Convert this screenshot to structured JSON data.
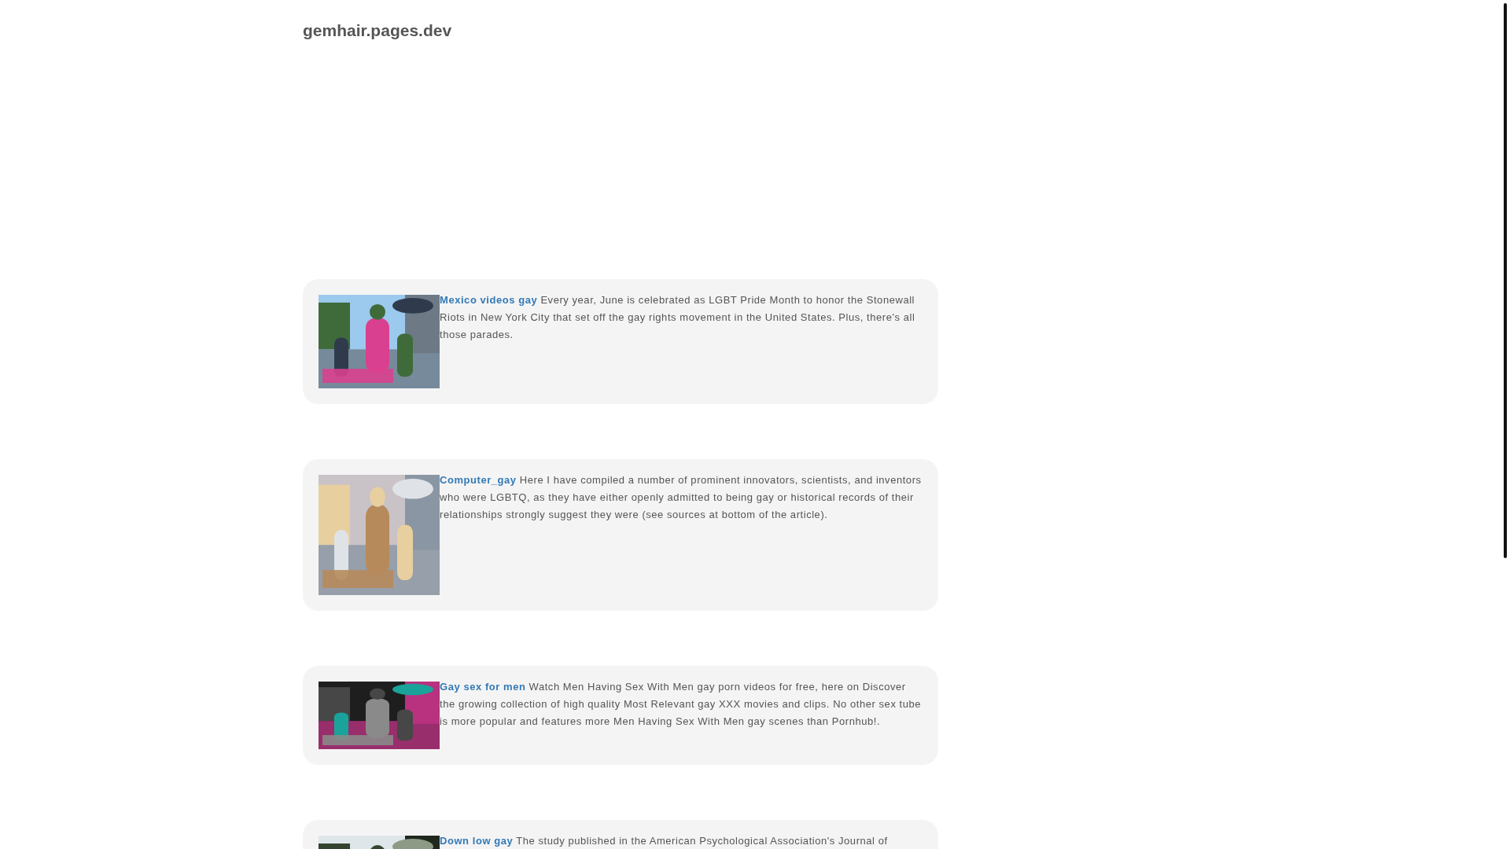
{
  "site_title": "gemhair.pages.dev",
  "posts": [
    {
      "title": "Mexico videos gay",
      "text": "Every year, June is celebrated as LGBT Pride Month to honor the Stonewall Riots in New York City that set off the gay rights movement in the United States. Plus, there's all those parades."
    },
    {
      "title": "Computer_gay",
      "text": "Here I have compiled a number of prominent innovators, scientists, and inventors who were LGBTQ, as they have either openly admitted to being gay or historical records of their relationships strongly suggest they were (see sources at bottom of the article)."
    },
    {
      "title": "Gay sex for men",
      "text": "Watch Men Having Sex With Men gay porn videos for free, here on Discover the growing collection of high quality Most Relevant gay XXX movies and clips. No other sex tube is more popular and features more Men Having Sex With Men gay scenes than Pornhub!."
    },
    {
      "title": "Down low gay",
      "text": "The study published in the American Psychological Association's Journal of"
    }
  ]
}
